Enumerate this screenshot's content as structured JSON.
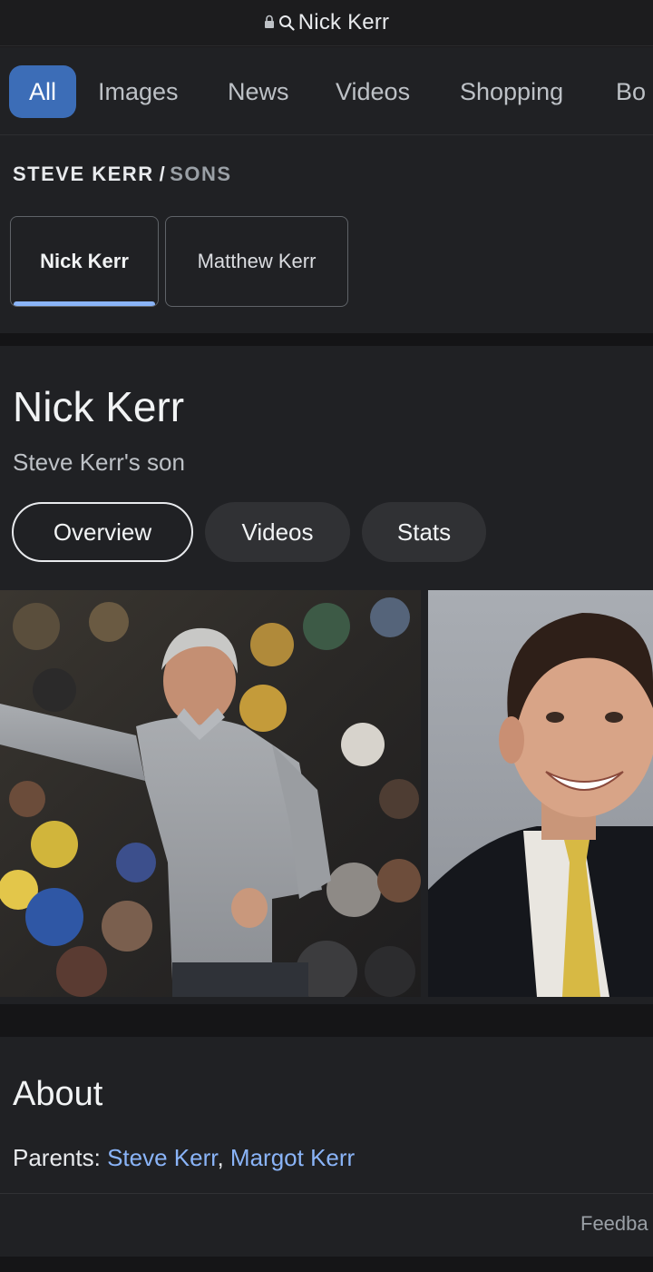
{
  "browser": {
    "address_text": "Nick Kerr"
  },
  "search_tabs": {
    "items": [
      {
        "label": "All"
      },
      {
        "label": "Images"
      },
      {
        "label": "News"
      },
      {
        "label": "Videos"
      },
      {
        "label": "Shopping"
      },
      {
        "label": "Bo"
      }
    ],
    "active": "All"
  },
  "breadcrumb": {
    "parent": "STEVE KERR",
    "separator": "/",
    "current": "SONS"
  },
  "sons": {
    "items": [
      {
        "label": "Nick Kerr",
        "selected": true
      },
      {
        "label": "Matthew Kerr",
        "selected": false
      }
    ]
  },
  "entity": {
    "title": "Nick Kerr",
    "subtitle": "Steve Kerr's son",
    "pills": [
      {
        "label": "Overview",
        "selected": true
      },
      {
        "label": "Videos",
        "selected": false
      },
      {
        "label": "Stats",
        "selected": false
      }
    ]
  },
  "about": {
    "heading": "About",
    "parents_label": "Parents: ",
    "parent_1": "Steve Kerr",
    "parent_sep": ", ",
    "parent_2": "Margot Kerr"
  },
  "feedback": {
    "label": "Feedba"
  },
  "colors": {
    "accent_tab": "#3c6db7",
    "link": "#8ab4f8",
    "background": "#202124"
  }
}
